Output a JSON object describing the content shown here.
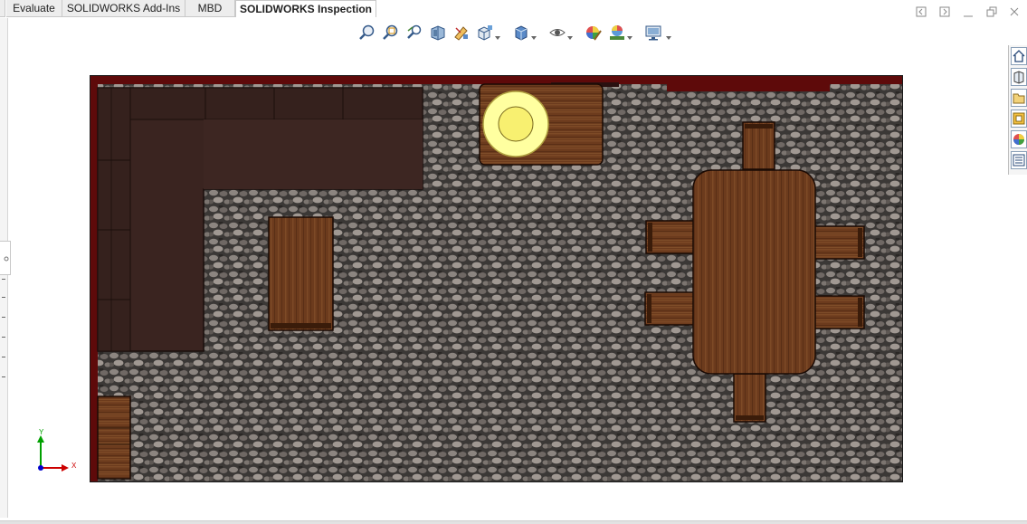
{
  "tabs": [
    {
      "label": "Evaluate",
      "active": false
    },
    {
      "label": "SOLIDWORKS Add-Ins",
      "active": false
    },
    {
      "label": "MBD",
      "active": false
    },
    {
      "label": "SOLIDWORKS Inspection",
      "active": true
    }
  ],
  "view_toolbar": {
    "icons": [
      "zoom-to-fit-icon",
      "zoom-to-area-icon",
      "previous-view-icon",
      "section-view-icon",
      "dynamic-annotation-icon",
      "view-orientation-icon",
      "display-style-icon",
      "hide-show-items-icon",
      "edit-appearance-icon",
      "apply-scene-icon",
      "view-settings-icon"
    ]
  },
  "window_controls": [
    "restore-left-icon",
    "restore-right-icon",
    "minimize-icon",
    "restore-icon",
    "close-icon"
  ],
  "task_pane": {
    "icons": [
      "home-icon",
      "design-library-icon",
      "file-explorer-icon",
      "view-palette-icon",
      "appearances-icon",
      "custom-properties-icon"
    ]
  },
  "triad": {
    "x_label": "X",
    "y_label": "Y"
  },
  "colors": {
    "wall": "#5e0a0a",
    "carpet_base": "#3e3b39",
    "sofa": "#3a2420",
    "wood": "#6a3a1c",
    "lamp": "#ffffa0",
    "axis_x": "#cc0000",
    "axis_y": "#00a000",
    "axis_z": "#0000cc"
  }
}
